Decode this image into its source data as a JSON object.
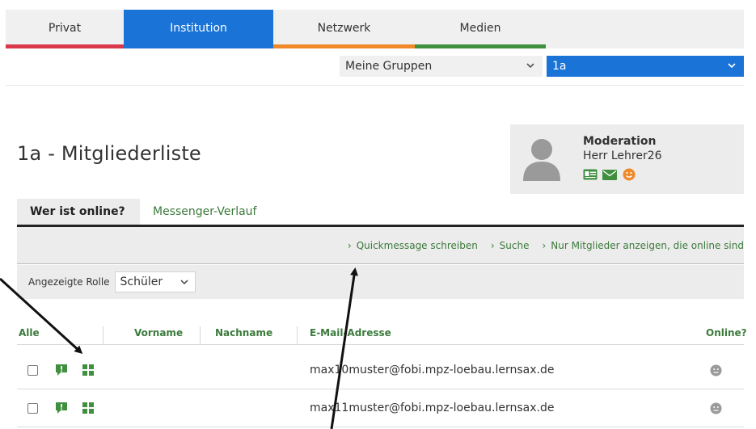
{
  "topnav": {
    "tabs": [
      {
        "label": "Privat"
      },
      {
        "label": "Institution"
      },
      {
        "label": "Netzwerk"
      },
      {
        "label": "Medien"
      }
    ]
  },
  "selectors": {
    "groups_value": "Meine Gruppen",
    "class_value": "1a"
  },
  "page": {
    "title": "1a - Mitgliederliste"
  },
  "moderation": {
    "title": "Moderation",
    "name": "Herr Lehrer26",
    "icons": [
      "contact-card-icon",
      "envelope-icon",
      "smiley-icon"
    ]
  },
  "subtabs": [
    {
      "label": "Wer ist online?",
      "active": true
    },
    {
      "label": "Messenger-Verlauf",
      "active": false
    }
  ],
  "actions": [
    {
      "label": "Quickmessage schreiben"
    },
    {
      "label": "Suche"
    },
    {
      "label": "Nur Mitglieder anzeigen, die online sind"
    }
  ],
  "role": {
    "label": "Angezeigte Rolle",
    "value": "Schüler"
  },
  "table": {
    "headers": {
      "all": "Alle",
      "firstname": "Vorname",
      "lastname": "Nachname",
      "email": "E-Mail-Adresse",
      "online": "Online?"
    },
    "rows": [
      {
        "email": "max10muster@fobi.mpz-loebau.lernsax.de"
      },
      {
        "email": "max11muster@fobi.mpz-loebau.lernsax.de"
      }
    ]
  },
  "colors": {
    "accent_blue": "#1a73d6",
    "link_green": "#3b7a3b",
    "privat_red": "#d9394a",
    "netzwerk_orange": "#f0892a",
    "medien_green": "#3f8f3f"
  }
}
